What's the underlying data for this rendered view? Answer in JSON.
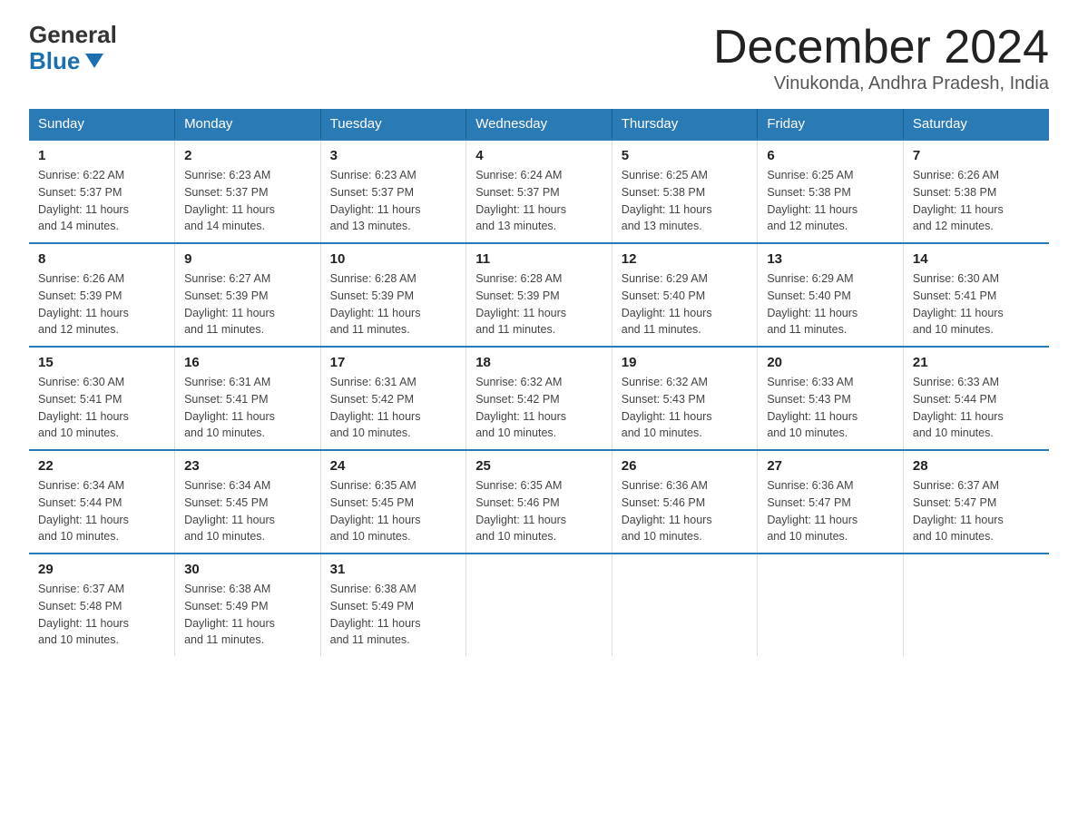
{
  "logo": {
    "general": "General",
    "blue": "Blue"
  },
  "header": {
    "month": "December 2024",
    "location": "Vinukonda, Andhra Pradesh, India"
  },
  "days_of_week": [
    "Sunday",
    "Monday",
    "Tuesday",
    "Wednesday",
    "Thursday",
    "Friday",
    "Saturday"
  ],
  "weeks": [
    [
      {
        "day": "1",
        "sunrise": "6:22 AM",
        "sunset": "5:37 PM",
        "daylight": "11 hours and 14 minutes."
      },
      {
        "day": "2",
        "sunrise": "6:23 AM",
        "sunset": "5:37 PM",
        "daylight": "11 hours and 14 minutes."
      },
      {
        "day": "3",
        "sunrise": "6:23 AM",
        "sunset": "5:37 PM",
        "daylight": "11 hours and 13 minutes."
      },
      {
        "day": "4",
        "sunrise": "6:24 AM",
        "sunset": "5:37 PM",
        "daylight": "11 hours and 13 minutes."
      },
      {
        "day": "5",
        "sunrise": "6:25 AM",
        "sunset": "5:38 PM",
        "daylight": "11 hours and 13 minutes."
      },
      {
        "day": "6",
        "sunrise": "6:25 AM",
        "sunset": "5:38 PM",
        "daylight": "11 hours and 12 minutes."
      },
      {
        "day": "7",
        "sunrise": "6:26 AM",
        "sunset": "5:38 PM",
        "daylight": "11 hours and 12 minutes."
      }
    ],
    [
      {
        "day": "8",
        "sunrise": "6:26 AM",
        "sunset": "5:39 PM",
        "daylight": "11 hours and 12 minutes."
      },
      {
        "day": "9",
        "sunrise": "6:27 AM",
        "sunset": "5:39 PM",
        "daylight": "11 hours and 11 minutes."
      },
      {
        "day": "10",
        "sunrise": "6:28 AM",
        "sunset": "5:39 PM",
        "daylight": "11 hours and 11 minutes."
      },
      {
        "day": "11",
        "sunrise": "6:28 AM",
        "sunset": "5:39 PM",
        "daylight": "11 hours and 11 minutes."
      },
      {
        "day": "12",
        "sunrise": "6:29 AM",
        "sunset": "5:40 PM",
        "daylight": "11 hours and 11 minutes."
      },
      {
        "day": "13",
        "sunrise": "6:29 AM",
        "sunset": "5:40 PM",
        "daylight": "11 hours and 11 minutes."
      },
      {
        "day": "14",
        "sunrise": "6:30 AM",
        "sunset": "5:41 PM",
        "daylight": "11 hours and 10 minutes."
      }
    ],
    [
      {
        "day": "15",
        "sunrise": "6:30 AM",
        "sunset": "5:41 PM",
        "daylight": "11 hours and 10 minutes."
      },
      {
        "day": "16",
        "sunrise": "6:31 AM",
        "sunset": "5:41 PM",
        "daylight": "11 hours and 10 minutes."
      },
      {
        "day": "17",
        "sunrise": "6:31 AM",
        "sunset": "5:42 PM",
        "daylight": "11 hours and 10 minutes."
      },
      {
        "day": "18",
        "sunrise": "6:32 AM",
        "sunset": "5:42 PM",
        "daylight": "11 hours and 10 minutes."
      },
      {
        "day": "19",
        "sunrise": "6:32 AM",
        "sunset": "5:43 PM",
        "daylight": "11 hours and 10 minutes."
      },
      {
        "day": "20",
        "sunrise": "6:33 AM",
        "sunset": "5:43 PM",
        "daylight": "11 hours and 10 minutes."
      },
      {
        "day": "21",
        "sunrise": "6:33 AM",
        "sunset": "5:44 PM",
        "daylight": "11 hours and 10 minutes."
      }
    ],
    [
      {
        "day": "22",
        "sunrise": "6:34 AM",
        "sunset": "5:44 PM",
        "daylight": "11 hours and 10 minutes."
      },
      {
        "day": "23",
        "sunrise": "6:34 AM",
        "sunset": "5:45 PM",
        "daylight": "11 hours and 10 minutes."
      },
      {
        "day": "24",
        "sunrise": "6:35 AM",
        "sunset": "5:45 PM",
        "daylight": "11 hours and 10 minutes."
      },
      {
        "day": "25",
        "sunrise": "6:35 AM",
        "sunset": "5:46 PM",
        "daylight": "11 hours and 10 minutes."
      },
      {
        "day": "26",
        "sunrise": "6:36 AM",
        "sunset": "5:46 PM",
        "daylight": "11 hours and 10 minutes."
      },
      {
        "day": "27",
        "sunrise": "6:36 AM",
        "sunset": "5:47 PM",
        "daylight": "11 hours and 10 minutes."
      },
      {
        "day": "28",
        "sunrise": "6:37 AM",
        "sunset": "5:47 PM",
        "daylight": "11 hours and 10 minutes."
      }
    ],
    [
      {
        "day": "29",
        "sunrise": "6:37 AM",
        "sunset": "5:48 PM",
        "daylight": "11 hours and 10 minutes."
      },
      {
        "day": "30",
        "sunrise": "6:38 AM",
        "sunset": "5:49 PM",
        "daylight": "11 hours and 11 minutes."
      },
      {
        "day": "31",
        "sunrise": "6:38 AM",
        "sunset": "5:49 PM",
        "daylight": "11 hours and 11 minutes."
      },
      null,
      null,
      null,
      null
    ]
  ],
  "labels": {
    "sunrise": "Sunrise:",
    "sunset": "Sunset:",
    "daylight": "Daylight:"
  }
}
